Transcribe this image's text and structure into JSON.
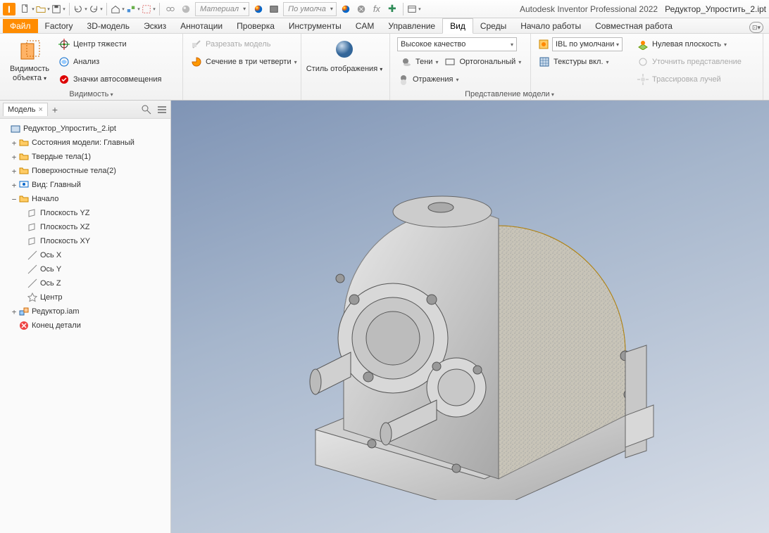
{
  "titlebar": {
    "app": "Autodesk Inventor Professional 2022",
    "doc": "Редуктор_Упростить_2.ipt"
  },
  "qat": {
    "material_placeholder": "Материал",
    "appearance_placeholder": "По умолча"
  },
  "tabs": {
    "file": "Файл",
    "items": [
      "Factory",
      "3D-модель",
      "Эскиз",
      "Аннотации",
      "Проверка",
      "Инструменты",
      "CAM",
      "Управление",
      "Вид",
      "Среды",
      "Начало работы",
      "Совместная работа"
    ],
    "active": "Вид"
  },
  "ribbon": {
    "visibility": {
      "big": "Видимость\nобъекта",
      "cog": "Центр тяжести",
      "analysis": "Анализ",
      "automark": "Значки автосовмещения",
      "panel": "Видимость"
    },
    "section": {
      "cut": "Разрезать модель",
      "quarter": "Сечение в три четверти"
    },
    "style": {
      "big": "Стиль отображения"
    },
    "quality": {
      "combo": "Высокое качество",
      "shadows": "Тени",
      "reflections": "Отражения",
      "ortho": "Ортогональный",
      "ibl": "IBL по умолчани",
      "textures": "Текстуры вкл."
    },
    "ground": {
      "plane": "Нулевая плоскость",
      "refine": "Уточнить представление",
      "trace": "Трассировка лучей"
    },
    "view_panel": "Представление модели"
  },
  "sidebar": {
    "tab": "Модель"
  },
  "tree": {
    "root": "Редуктор_Упростить_2.ipt",
    "states": "Состояния модели: Главный",
    "solids": "Твердые тела(1)",
    "surfaces": "Поверхностные тела(2)",
    "view": "Вид: Главный",
    "origin": "Начало",
    "planes": {
      "yz": "Плоскость YZ",
      "xz": "Плоскость XZ",
      "xy": "Плоскость XY"
    },
    "axes": {
      "x": "Ось X",
      "y": "Ось Y",
      "z": "Ось Z"
    },
    "center": "Центр",
    "reductor": "Редуктор.iam",
    "end": "Конец детали"
  }
}
